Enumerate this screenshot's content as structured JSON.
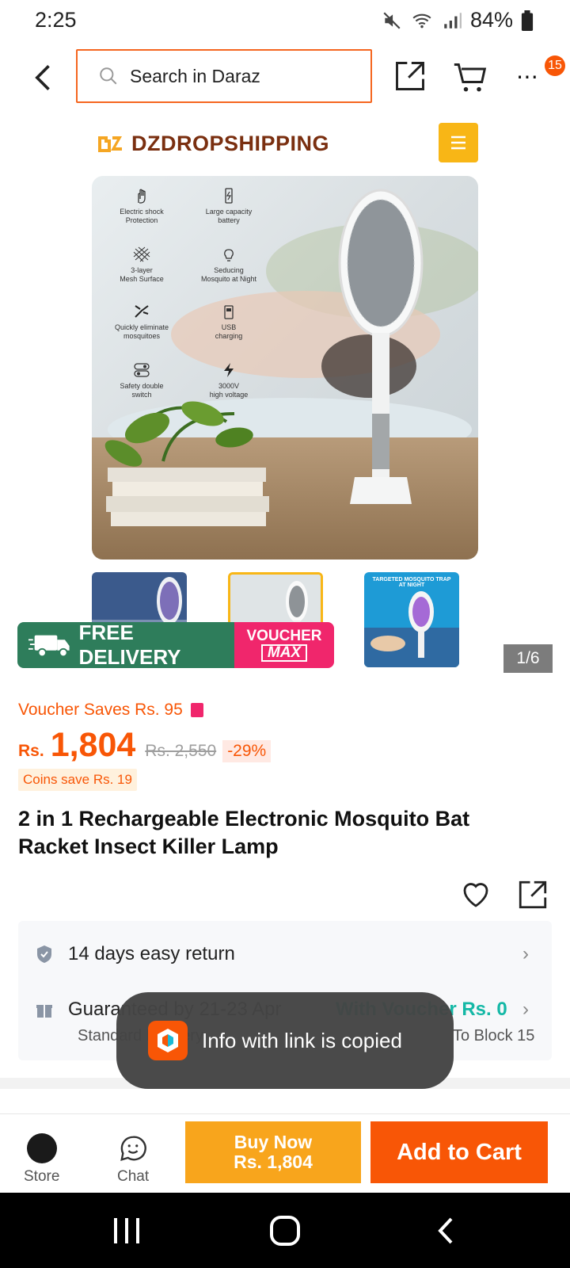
{
  "status_bar": {
    "time": "2:25",
    "battery": "84%"
  },
  "header": {
    "search_placeholder": "Search in Daraz",
    "cart_count": "15"
  },
  "gallery": {
    "brand": "DZDROPSHIPPING",
    "features": [
      {
        "line1": "Electric shock",
        "line2": "Protection"
      },
      {
        "line1": "Large capacity",
        "line2": "battery"
      },
      {
        "line1": "3-layer",
        "line2": "Mesh Surface"
      },
      {
        "line1": "Seducing",
        "line2": "Mosquito at Night"
      },
      {
        "line1": "Quickly eliminate",
        "line2": "mosquitoes"
      },
      {
        "line1": "USB",
        "line2": "charging"
      },
      {
        "line1": "Safety double",
        "line2": "switch"
      },
      {
        "line1": "3000V",
        "line2": "high voltage"
      }
    ],
    "thumb3_caption": "TARGETED MOSQUITO TRAP AT NIGHT",
    "counter": "1/6"
  },
  "promo": {
    "free_delivery": "FREE DELIVERY",
    "free_tag": "FREE",
    "voucher": "VOUCHER",
    "max": "MAX"
  },
  "pricing": {
    "voucher_saves": "Voucher Saves Rs. 95",
    "currency": "Rs.",
    "price": "1,804",
    "old_price": "Rs. 2,550",
    "discount": "-29%",
    "coins": "Coins save Rs. 19"
  },
  "product": {
    "title": "2 in 1 Rechargeable Electronic Mosquito Bat Racket Insect Killer Lamp"
  },
  "info": {
    "returns": "14 days easy return",
    "guarantee": "Guaranteed by 21-23 Apr",
    "voucher_ship": "With Voucher Rs. 0",
    "standard": "Standard Delivery",
    "block": "To Block 15"
  },
  "toast": {
    "text": "Info with link is copied"
  },
  "bottom": {
    "store": "Store",
    "chat": "Chat",
    "buy_now": "Buy Now",
    "buy_price": "Rs. 1,804",
    "add_to_cart": "Add to Cart"
  },
  "colors": {
    "accent": "#f85606",
    "voucher_pink": "#f0266c",
    "delivery_green": "#2e7d5b",
    "teal": "#14b8a6"
  }
}
